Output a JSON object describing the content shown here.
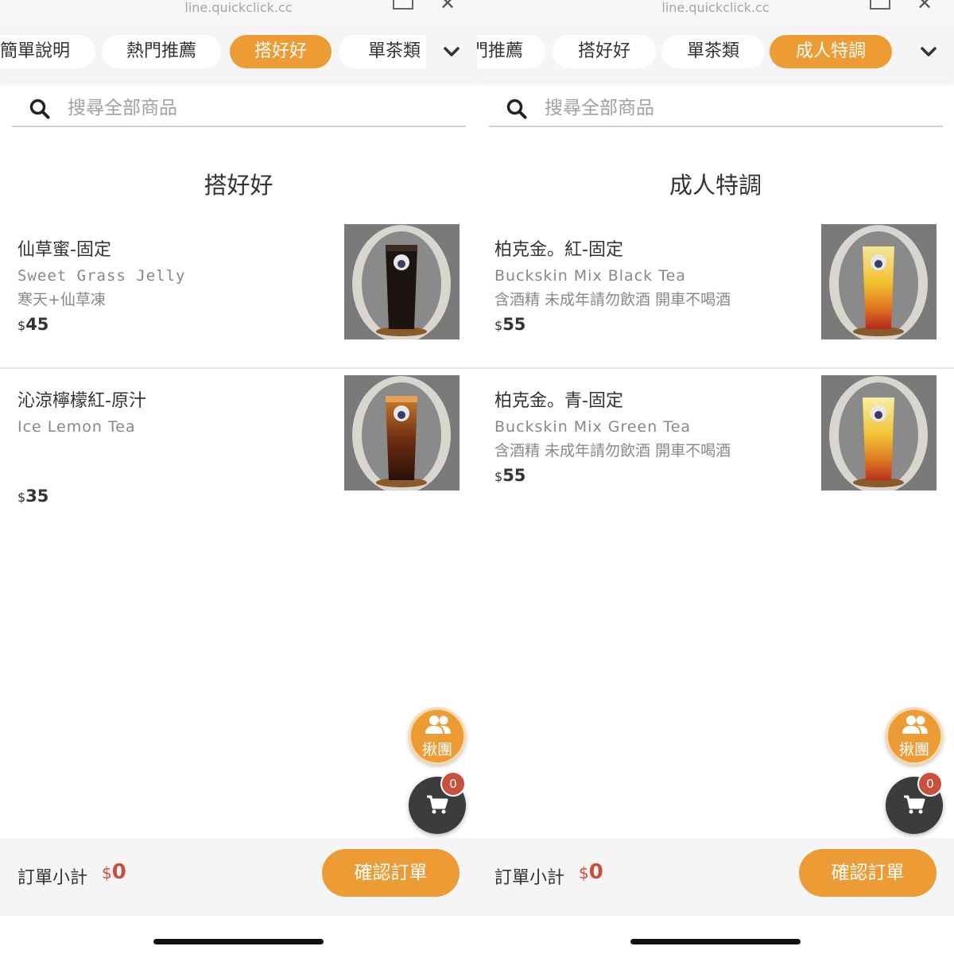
{
  "left": {
    "url": "line.quickclick.cc",
    "tabs": [
      "簡單說明",
      "熱門推薦",
      "搭好好",
      "單茶類"
    ],
    "active_tab": "搭好好",
    "search": {
      "placeholder": "搜尋全部商品"
    },
    "category_title": "搭好好",
    "items": [
      {
        "name": "仙草蜜-固定",
        "name_en": "Sweet Grass Jelly",
        "desc": "寒天+仙草凍",
        "currency": "$",
        "price": "45"
      },
      {
        "name": "沁涼檸檬紅-原汁",
        "name_en": "Ice Lemon Tea",
        "desc": "",
        "currency": "$",
        "price": "35"
      }
    ],
    "group_button_label": "揪團",
    "cart_count": "0",
    "footer": {
      "subtotal_label": "訂單小計",
      "currency": "$",
      "subtotal": "0",
      "confirm_label": "確認訂單"
    }
  },
  "right": {
    "url": "line.quickclick.cc",
    "tabs": [
      "門推薦",
      "搭好好",
      "單茶類",
      "成人特調"
    ],
    "active_tab": "成人特調",
    "search": {
      "placeholder": "搜尋全部商品"
    },
    "category_title": "成人特調",
    "items": [
      {
        "name": "柏克金。紅-固定",
        "name_en": "Buckskin Mix Black Tea",
        "desc": "含酒精 未成年請勿飲酒 開車不喝酒",
        "currency": "$",
        "price": "55"
      },
      {
        "name": "柏克金。青-固定",
        "name_en": "Buckskin Mix Green Tea",
        "desc": "含酒精 未成年請勿飲酒 開車不喝酒",
        "currency": "$",
        "price": "55"
      }
    ],
    "group_button_label": "揪團",
    "cart_count": "0",
    "footer": {
      "subtotal_label": "訂單小計",
      "currency": "$",
      "subtotal": "0",
      "confirm_label": "確認訂單"
    }
  },
  "colors": {
    "accent": "#ec9b35",
    "price_red": "#c8513d",
    "cart_dark": "#3c3c3c"
  },
  "icons": [
    "search-icon",
    "chevron-down-icon",
    "group-icon",
    "cart-icon",
    "share-icon",
    "close-icon"
  ]
}
